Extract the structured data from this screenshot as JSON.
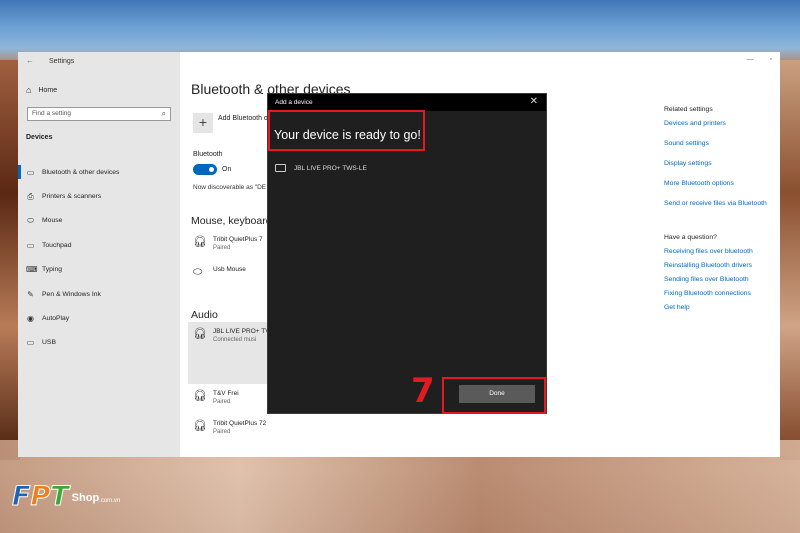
{
  "settings": {
    "window_title": "Settings",
    "home": "Home",
    "search_placeholder": "Find a setting",
    "section": "Devices",
    "nav": [
      {
        "label": "Bluetooth & other devices",
        "icon": "bluetooth-icon"
      },
      {
        "label": "Printers & scanners",
        "icon": "printer-icon"
      },
      {
        "label": "Mouse",
        "icon": "mouse-icon"
      },
      {
        "label": "Touchpad",
        "icon": "touchpad-icon"
      },
      {
        "label": "Typing",
        "icon": "keyboard-icon"
      },
      {
        "label": "Pen & Windows Ink",
        "icon": "pen-icon"
      },
      {
        "label": "AutoPlay",
        "icon": "autoplay-icon"
      },
      {
        "label": "USB",
        "icon": "usb-icon"
      }
    ]
  },
  "main": {
    "title": "Bluetooth & other devices",
    "add_label": "Add Bluetooth o",
    "bluetooth_label": "Bluetooth",
    "toggle_state": "On",
    "discoverable": "Now discoverable as \"DE",
    "mouse_heading": "Mouse, keyboard",
    "mouse_devices": [
      {
        "name": "Tribit QuietPlus 7",
        "status": "Paired",
        "icon": "headset-icon"
      },
      {
        "name": "Usb Mouse",
        "status": "",
        "icon": "mouse-icon"
      }
    ],
    "audio_heading": "Audio",
    "audio_devices": [
      {
        "name": "JBL LIVE PRO+ TV",
        "status": "Connected musi",
        "icon": "headset-icon"
      },
      {
        "name": "T&V Frei",
        "status": "Paired",
        "icon": "headset-icon"
      },
      {
        "name": "Tribit QuietPlus 72",
        "status": "Paired",
        "icon": "headset-icon"
      }
    ]
  },
  "related": {
    "title": "Related settings",
    "links": [
      "Devices and printers",
      "Sound settings",
      "Display settings",
      "More Bluetooth options",
      "Send or receive files via Bluetooth"
    ],
    "question_title": "Have a question?",
    "question_links": [
      "Receiving files over bluetooth",
      "Reinstalling Bluetooth drivers",
      "Sending files over Bluetooth",
      "Fixing Bluetooth connections",
      "Get help"
    ]
  },
  "dialog": {
    "title": "Add a device",
    "heading": "Your device is ready to go!",
    "device": "JBL LIVE PRO+ TWS-LE",
    "done": "Done"
  },
  "annotation": {
    "step": "7",
    "color": "#e21b23"
  },
  "logo": {
    "f": "F",
    "p": "P",
    "t": "T",
    "shop": "Shop",
    "domain": ".com.vn"
  },
  "colors": {
    "accent": "#0067c0",
    "dialog_bg": "#1f1f1f"
  }
}
